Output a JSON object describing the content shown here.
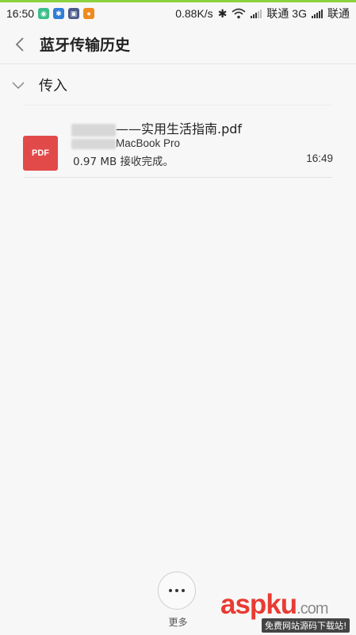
{
  "status_bar": {
    "time": "16:50",
    "speed": "0.88K/s",
    "carrier1": "联通 3G",
    "carrier2": "联通",
    "app_icons": [
      "shield-app-icon",
      "bluetooth-app-icon",
      "gallery-app-icon",
      "orange-app-icon"
    ]
  },
  "header": {
    "title": "蓝牙传输历史"
  },
  "section": {
    "label": "传入"
  },
  "transfer": {
    "file_icon_label": "PDF",
    "file_name_visible": "——实用生活指南.pdf",
    "device_visible": "MacBook Pro",
    "size_status": "0.97 MB 接收完成。",
    "time": "16:49"
  },
  "footer": {
    "more_label": "更多"
  },
  "watermark": {
    "main": "asp",
    "main2": "ku",
    "suffix": ".com",
    "sub": "免费网站源码下载站!"
  },
  "colors": {
    "pdf_red": "#e24a4a",
    "top_accent": "#8bd23f",
    "watermark_red": "#e83b33"
  }
}
